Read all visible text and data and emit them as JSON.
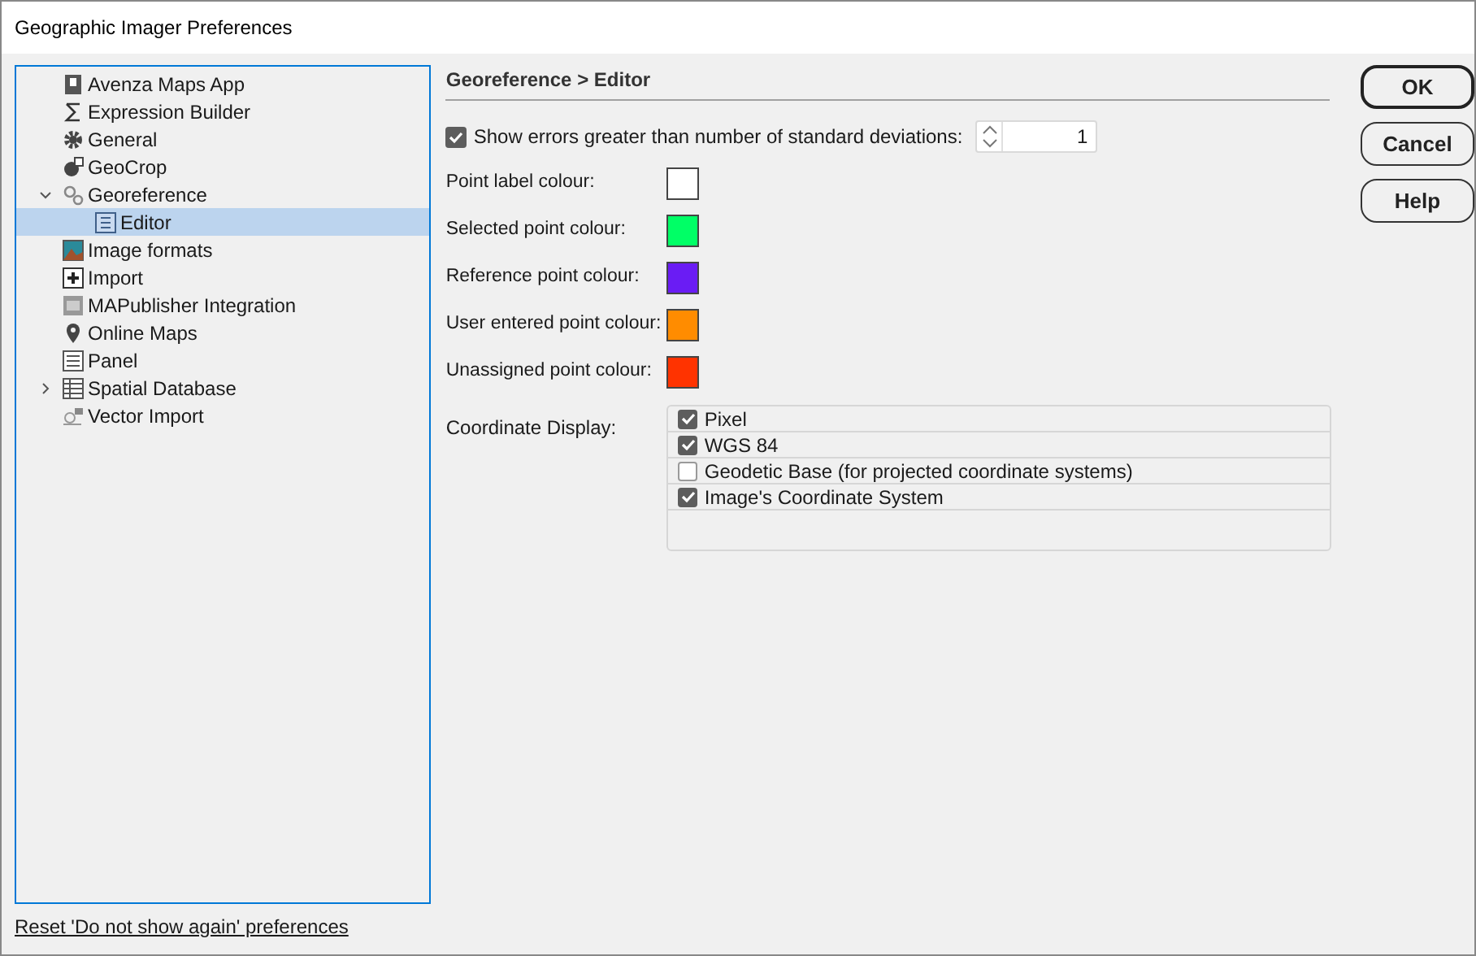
{
  "window": {
    "title": "Geographic Imager Preferences"
  },
  "tree": [
    {
      "label": "Avenza Maps App",
      "selected": false
    },
    {
      "label": "Expression Builder",
      "selected": false
    },
    {
      "label": "General",
      "selected": false
    },
    {
      "label": "GeoCrop",
      "selected": false
    },
    {
      "label": "Georeference",
      "selected": false,
      "expanded": true,
      "children": [
        {
          "label": "Editor",
          "selected": true
        }
      ]
    },
    {
      "label": "Image formats",
      "selected": false
    },
    {
      "label": "Import",
      "selected": false
    },
    {
      "label": "MAPublisher Integration",
      "selected": false
    },
    {
      "label": "Online Maps",
      "selected": false
    },
    {
      "label": "Panel",
      "selected": false
    },
    {
      "label": "Spatial Database",
      "selected": false,
      "expanded": false
    },
    {
      "label": "Vector Import",
      "selected": false
    }
  ],
  "panel": {
    "heading": "Georeference > Editor",
    "show_errors": {
      "label": "Show errors greater than number of standard deviations:",
      "checked": true,
      "value": "1"
    },
    "colours": [
      {
        "label": "Point label colour:",
        "color": "#ffffff"
      },
      {
        "label": "Selected point colour:",
        "color": "#00ff66"
      },
      {
        "label": "Reference point colour:",
        "color": "#6a1cf4"
      },
      {
        "label": "User entered point colour:",
        "color": "#ff8c00"
      },
      {
        "label": "Unassigned point colour:",
        "color": "#ff3300"
      }
    ],
    "coordinate_display": {
      "label": "Coordinate Display:",
      "options": [
        {
          "label": "Pixel",
          "checked": true
        },
        {
          "label": "WGS 84",
          "checked": true
        },
        {
          "label": "Geodetic Base (for projected coordinate systems)",
          "checked": false
        },
        {
          "label": "Image's Coordinate System",
          "checked": true
        }
      ]
    }
  },
  "buttons": [
    {
      "label": "OK",
      "default": true
    },
    {
      "label": "Cancel",
      "default": false
    },
    {
      "label": "Help",
      "default": false
    }
  ],
  "reset_link": "Reset 'Do not show again' preferences"
}
